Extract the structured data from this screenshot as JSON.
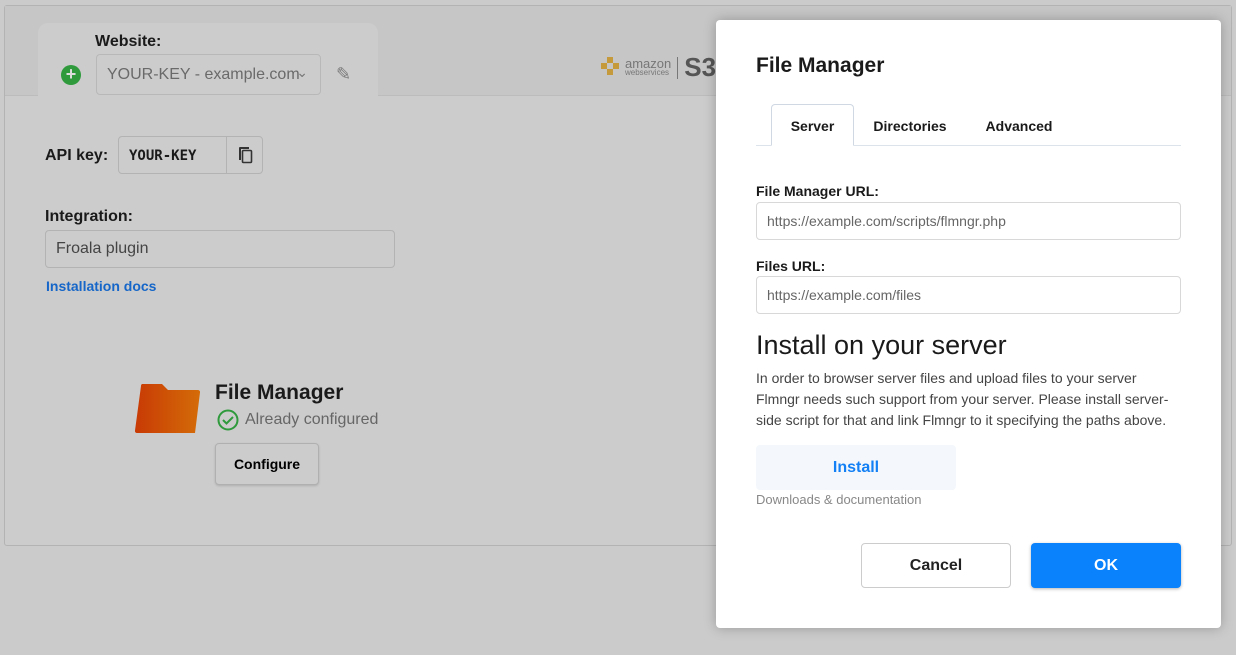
{
  "website": {
    "label": "Website:",
    "selected": "YOUR-KEY - example.com",
    "add_icon": "plus-circle-icon",
    "edit_icon": "pencil-icon"
  },
  "logo": {
    "text": "amazon web services S3"
  },
  "api_key": {
    "label": "API key:",
    "value": "YOUR-KEY",
    "copy_icon": "copy-icon"
  },
  "integration": {
    "label": "Integration:",
    "value": "Froala plugin",
    "docs_link": "Installation docs"
  },
  "file_manager_card": {
    "title": "File Manager",
    "status": "Already configured",
    "status_color": "#2e9a3c",
    "configure_label": "Configure"
  },
  "modal": {
    "title": "File Manager",
    "tabs": [
      {
        "label": "Server",
        "active": true
      },
      {
        "label": "Directories",
        "active": false
      },
      {
        "label": "Advanced",
        "active": false
      }
    ],
    "fm_url_label": "File Manager URL:",
    "fm_url_placeholder": "https://example.com/scripts/flmngr.php",
    "files_url_label": "Files URL:",
    "files_url_placeholder": "https://example.com/files",
    "install_heading": "Install on your server",
    "install_text": "In order to browser server files and upload files to your server Flmngr needs such support from your server. Please install server-side script for that and link Flmngr to it specifying the paths above.",
    "install_label": "Install",
    "install_sub": "Downloads & documentation",
    "cancel_label": "Cancel",
    "ok_label": "OK",
    "accent": "#0a82fb"
  }
}
